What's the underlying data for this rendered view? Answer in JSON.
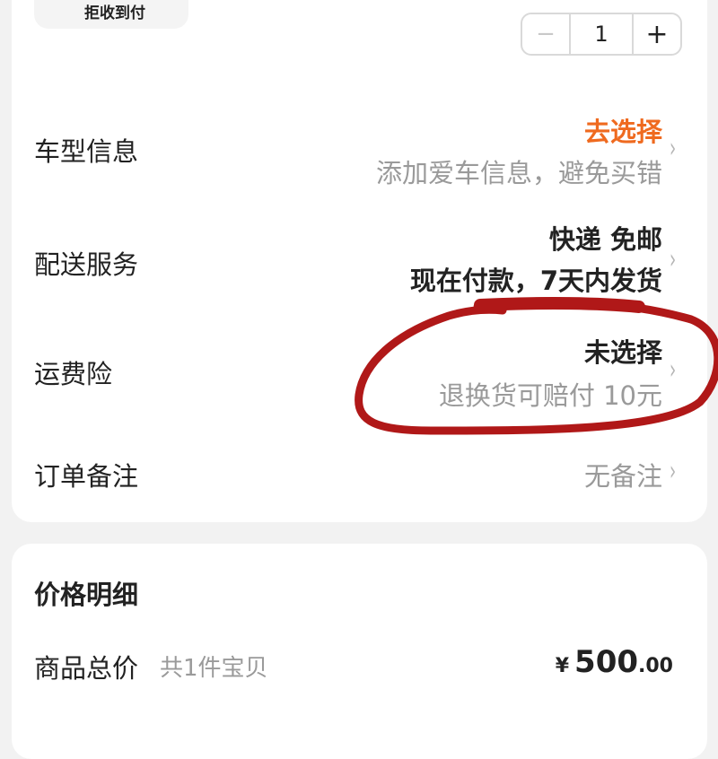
{
  "top": {
    "chip_label": "拒收到付",
    "stepper": {
      "minus": "−",
      "quantity": "1",
      "plus": "+"
    }
  },
  "rows": {
    "car": {
      "label": "车型信息",
      "action": "去选择",
      "hint": "添加爱车信息，避免买错"
    },
    "delivery": {
      "label": "配送服务",
      "line1": "快递 免邮",
      "line2": "现在付款，7天内发货"
    },
    "insurance": {
      "label": "运费险",
      "status": "未选择",
      "hint": "退换货可赔付 10元"
    },
    "note": {
      "label": "订单备注",
      "value": "无备注"
    }
  },
  "chevron": "›",
  "price_detail": {
    "title": "价格明细",
    "total_label": "商品总价",
    "count_text": "共1件宝贝",
    "currency": "¥",
    "amount_int": "500",
    "amount_dec": ".00"
  },
  "colors": {
    "accent": "#ef6a1f",
    "annotation": "#b01818"
  }
}
